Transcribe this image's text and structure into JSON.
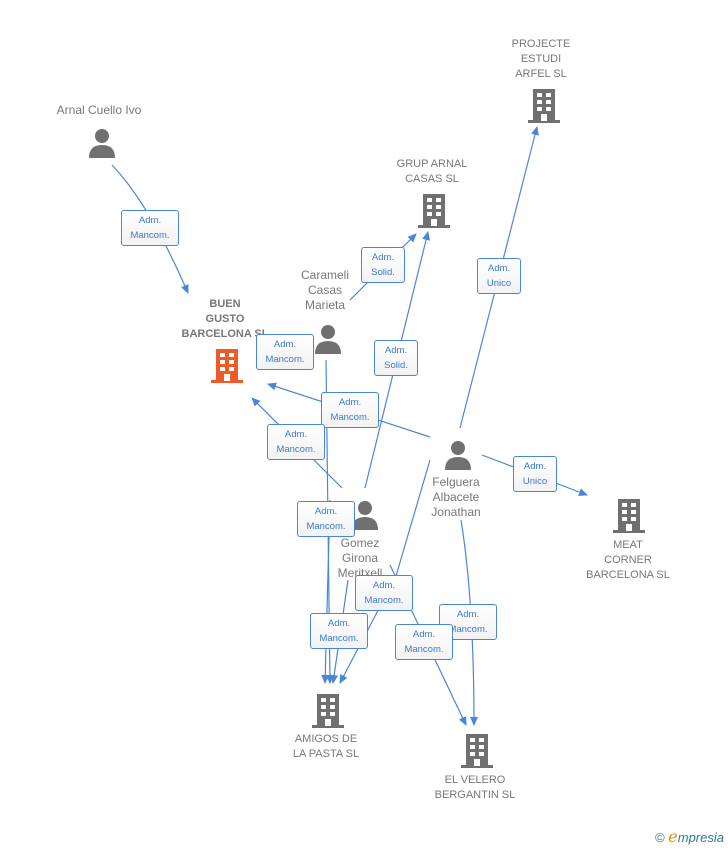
{
  "colors": {
    "edge": "#4a86d8",
    "company": "#707070",
    "focus_company": "#f05a28",
    "person": "#707070"
  },
  "nodes": {
    "arnal": {
      "label": "Arnal Cuello Ivo",
      "icon": "person-icon"
    },
    "buen_gusto": {
      "label": "BUEN\nGUSTO\nBARCELONA SL",
      "icon": "building-icon"
    },
    "carameli": {
      "label": "Carameli\nCasas\nMarieta",
      "icon": "person-icon"
    },
    "grup_arnal": {
      "label": "GRUP ARNAL\nCASAS SL",
      "icon": "building-icon"
    },
    "projecte": {
      "label": "PROJECTE\nESTUDI\nARFEL SL",
      "icon": "building-icon"
    },
    "felguera": {
      "label": "Felguera\nAlbacete\nJonathan",
      "icon": "person-icon"
    },
    "gomez": {
      "label": "Gomez\nGirona\nMeritxell",
      "icon": "person-icon"
    },
    "meat_corner": {
      "label": "MEAT\nCORNER\nBARCELONA  SL",
      "icon": "building-icon"
    },
    "amigos": {
      "label": "AMIGOS DE\nLA PASTA SL",
      "icon": "building-icon"
    },
    "velero": {
      "label": "EL VELERO\nBERGANTIN SL",
      "icon": "building-icon"
    }
  },
  "relations": [
    "Adm.\nMancom.",
    "Adm.\nSolid.",
    "Adm.\nSolid.",
    "Adm.\nUnico",
    "Adm.\nMancom.",
    "Adm.\nMancom.",
    "Adm.\nMancom.",
    "Adm.\nMancom.",
    "Adm.\nMancom.",
    "Adm.\nMancom.",
    "Adm.\nMancom.",
    "Adm.\nMancom.",
    "Adm.\nUnico"
  ],
  "watermark": {
    "copyright": "©",
    "brand_e": "e",
    "brand_rest": "mpresia"
  }
}
